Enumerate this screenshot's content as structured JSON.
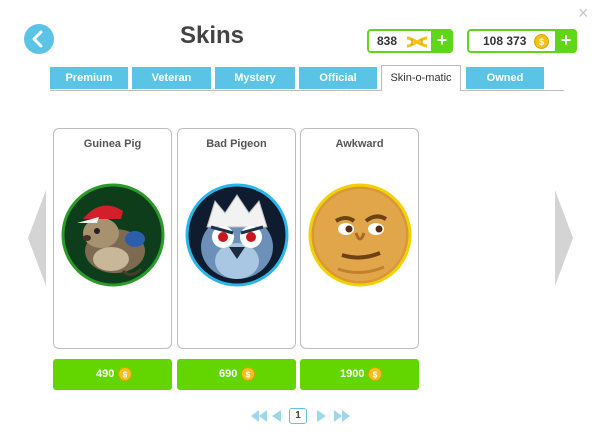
{
  "header": {
    "title": "Skins",
    "close": "×"
  },
  "currencies": [
    {
      "amount": "838",
      "icon": "dna-icon",
      "add": "+"
    },
    {
      "amount": "108 373",
      "icon": "coin-icon",
      "add": "+"
    }
  ],
  "tabs": [
    {
      "label": "Premium",
      "active": false
    },
    {
      "label": "Veteran",
      "active": false
    },
    {
      "label": "Mystery",
      "active": false
    },
    {
      "label": "Official",
      "active": false
    },
    {
      "label": "Skin-o-matic",
      "active": true
    },
    {
      "label": "Owned",
      "active": false
    }
  ],
  "skins": [
    {
      "name": "Guinea Pig",
      "price": "490",
      "ring_color": "#2a9a2a"
    },
    {
      "name": "Bad Pigeon",
      "price": "690",
      "ring_color": "#29b6ea"
    },
    {
      "name": "Awkward",
      "price": "1900",
      "ring_color": "#f5d000"
    }
  ],
  "pager": {
    "current": "1"
  },
  "colors": {
    "accent_blue": "#5bc4e6",
    "accent_green": "#63d600",
    "coin": "#f2c11a"
  }
}
